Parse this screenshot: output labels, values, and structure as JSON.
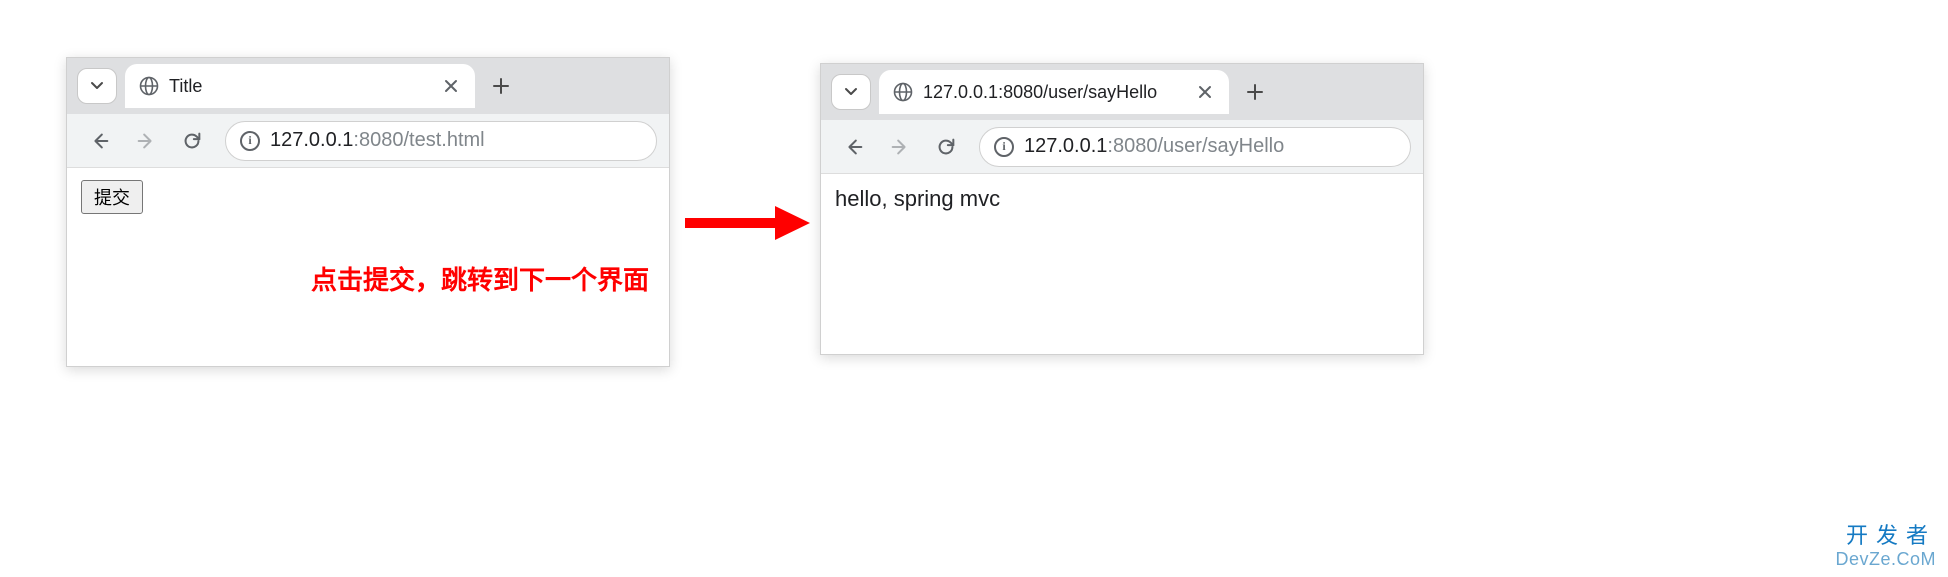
{
  "left_window": {
    "tab_title": "Title",
    "url_host": "127.0.0.1",
    "url_port": ":8080",
    "url_path": "/test.html",
    "submit_label": "提交",
    "caption": "点击提交，跳转到下一个界面"
  },
  "right_window": {
    "tab_title": "127.0.0.1:8080/user/sayHello",
    "url_host": "127.0.0.1",
    "url_port": ":8080",
    "url_path": "/user/sayHello",
    "body_text": "hello, spring mvc"
  },
  "watermark": {
    "line1": "开发者",
    "line2": "DevZe.CoM"
  }
}
